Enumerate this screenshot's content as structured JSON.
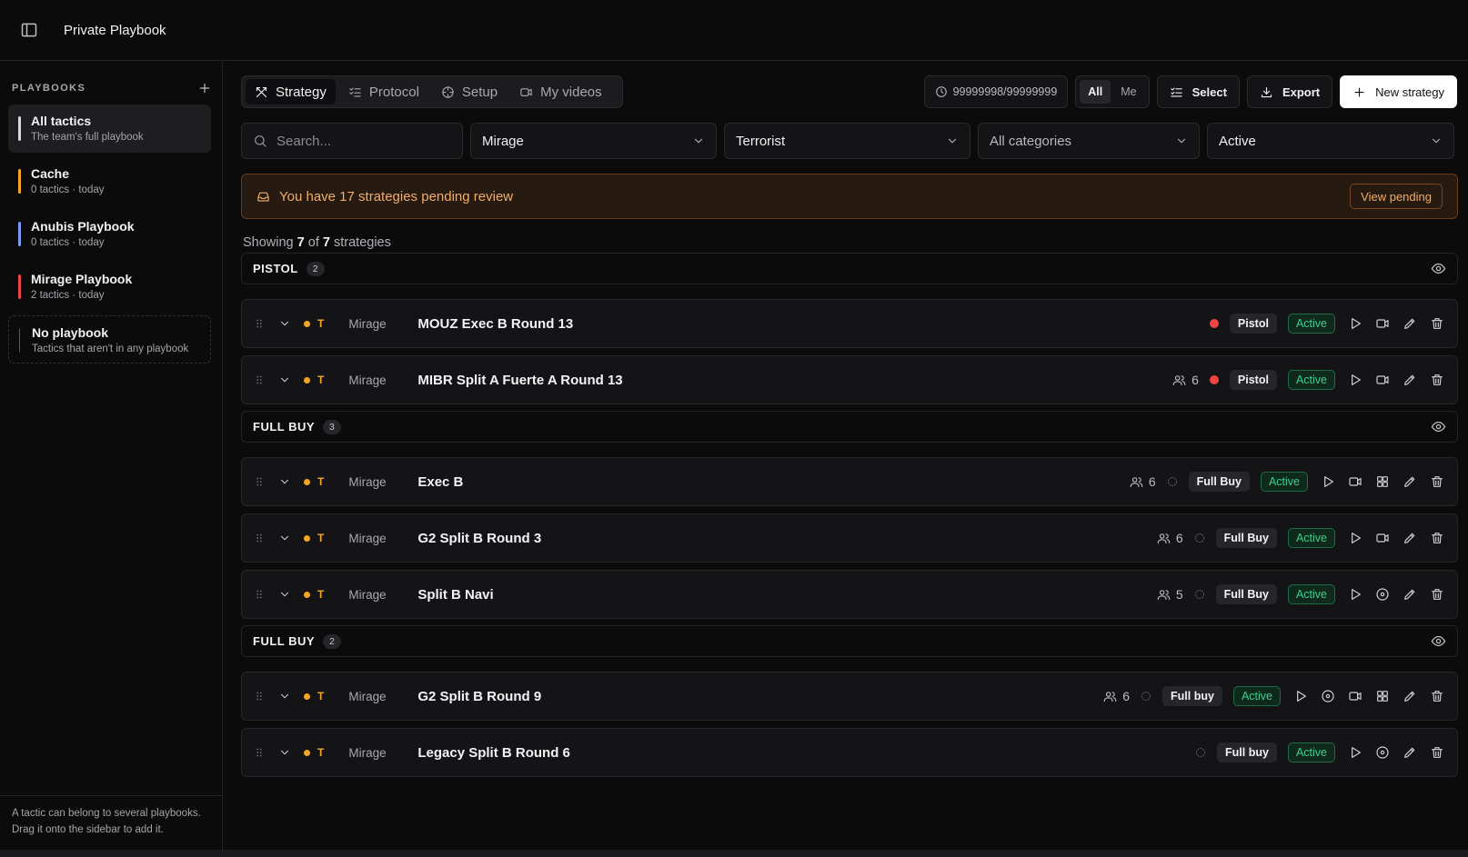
{
  "app": {
    "title": "Private Playbook"
  },
  "sidebar": {
    "heading": "PLAYBOOKS",
    "items": [
      {
        "name": "All tactics",
        "sub": "The team's full playbook",
        "color": "#d9d9dc"
      },
      {
        "name": "Cache",
        "sub": "0 tactics · today",
        "color": "#f5a524"
      },
      {
        "name": "Anubis Playbook",
        "sub": "0 tactics · today",
        "color": "#7b9cf5"
      },
      {
        "name": "Mirage Playbook",
        "sub": "2 tactics · today",
        "color": "#ef4444"
      },
      {
        "name": "No playbook",
        "sub": "Tactics that aren't in any playbook",
        "color": "#5a5a60"
      }
    ],
    "footer_line1": "A tactic can belong to several playbooks.",
    "footer_line2": "Drag it onto the sidebar to add it."
  },
  "tabs": [
    {
      "label": "Strategy",
      "icon": "strategy-icon"
    },
    {
      "label": "Protocol",
      "icon": "list-check-icon"
    },
    {
      "label": "Setup",
      "icon": "crosshair-icon"
    },
    {
      "label": "My videos",
      "icon": "video-icon"
    }
  ],
  "toolbar": {
    "counter": "99999998/99999999",
    "scope_all": "All",
    "scope_me": "Me",
    "select": "Select",
    "export": "Export",
    "new_strategy": "New strategy"
  },
  "filters": {
    "search_placeholder": "Search...",
    "map": "Mirage",
    "side": "Terrorist",
    "category": "All categories",
    "status": "Active"
  },
  "banner": {
    "message": "You have 17 strategies pending review",
    "button": "View pending"
  },
  "showing": {
    "prefix": "Showing",
    "shown": "7",
    "of": "of",
    "total": "7",
    "suffix": "strategies"
  },
  "groups": [
    {
      "label": "PISTOL",
      "count": "2"
    },
    {
      "label": "FULL BUY",
      "count": "3"
    },
    {
      "label": "FULL BUY",
      "count": "2"
    }
  ],
  "rows": [
    {
      "side": "T",
      "map": "Mirage",
      "name": "MOUZ Exec B Round 13",
      "players": "",
      "category": "Pistol",
      "status": "Active"
    },
    {
      "side": "T",
      "map": "Mirage",
      "name": "MIBR Split A Fuerte A Round 13",
      "players": "6",
      "category": "Pistol",
      "status": "Active"
    },
    {
      "side": "T",
      "map": "Mirage",
      "name": "Exec B",
      "players": "6",
      "category": "Full Buy",
      "status": "Active"
    },
    {
      "side": "T",
      "map": "Mirage",
      "name": "G2 Split B Round 3",
      "players": "6",
      "category": "Full Buy",
      "status": "Active"
    },
    {
      "side": "T",
      "map": "Mirage",
      "name": "Split B Navi",
      "players": "5",
      "category": "Full Buy",
      "status": "Active"
    },
    {
      "side": "T",
      "map": "Mirage",
      "name": "G2 Split B Round 9",
      "players": "6",
      "category": "Full buy",
      "status": "Active"
    },
    {
      "side": "T",
      "map": "Mirage",
      "name": "Legacy Split B Round 6",
      "players": "",
      "category": "Full buy",
      "status": "Active"
    }
  ],
  "colors": {
    "accent_t": "#f5a524",
    "active_green": "#3fcf8e",
    "warning": "#f0ad6a",
    "danger": "#ef4444"
  }
}
